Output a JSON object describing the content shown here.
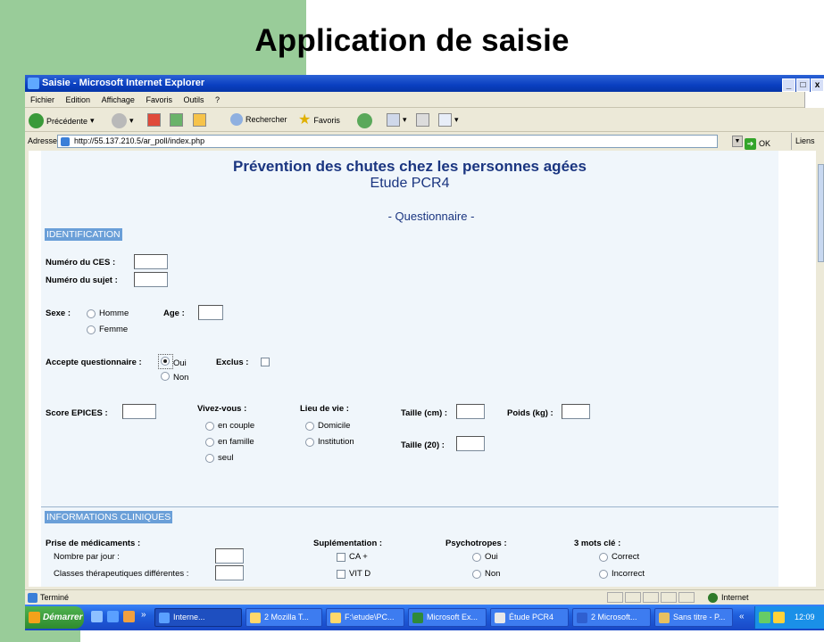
{
  "slide": {
    "title": "Application de saisie"
  },
  "browser": {
    "title": "Saisie - Microsoft Internet Explorer",
    "window_buttons": [
      "_",
      "□",
      "x"
    ],
    "menu": [
      "Fichier",
      "Edition",
      "Affichage",
      "Favoris",
      "Outils",
      "?"
    ],
    "toolbar": {
      "back": "Précédente",
      "search": "Rechercher",
      "favorites": "Favoris"
    },
    "address_label": "Adresse",
    "url": "http://55.137.210.5/ar_poll/index.php",
    "go_label": "OK",
    "links_label": "Liens"
  },
  "page": {
    "heading": "Prévention des chutes chez les personnes agées",
    "subheading": "Etude PCR4",
    "questionnaire": "- Questionnaire -",
    "section_identification": "IDENTIFICATION",
    "num_ces": "Numéro du CES :",
    "num_sujet": "Numéro du sujet :",
    "sexe": "Sexe :",
    "sexe_options": [
      "Homme",
      "Femme"
    ],
    "age": "Age :",
    "accepte": "Accepte questionnaire :",
    "accepte_options": [
      "Oui",
      "Non"
    ],
    "accepte_selected": "Oui",
    "exclus": "Exclus :",
    "score": "Score EPICES :",
    "vivez": "Vivez-vous :",
    "vivez_options": [
      "en couple",
      "en famille",
      "seul"
    ],
    "lieu": "Lieu de vie :",
    "lieu_options": [
      "Domicile",
      "Institution"
    ],
    "taille": "Taille (cm) :",
    "taille20": "Taille (20) :",
    "poids": "Poids (kg) :",
    "section_cliniques": "INFORMATIONS CLINIQUES",
    "prise": "Prise de médicaments :",
    "nombre": "Nombre par jour :",
    "classes": "Classes thérapeutiques différentes :",
    "suplementation": "Suplémentation :",
    "supl_options": [
      "CA +",
      "VIT D"
    ],
    "psychotropes": "Psychotropes :",
    "psy_options": [
      "Oui",
      "Non"
    ],
    "mots": "3 mots clé :",
    "mots_options": [
      "Correct",
      "Incorrect"
    ]
  },
  "status": {
    "text": "Terminé",
    "zone": "Internet"
  },
  "taskbar": {
    "start": "Démarrer",
    "tasks": [
      "Interne...",
      "2 Mozilla T...",
      "F:\\etude\\PC...",
      "Microsoft Ex...",
      "Étude PCR4",
      "2 Microsoft...",
      "Sans titre - P..."
    ],
    "clock": "12:09"
  },
  "colors": {
    "title_blue": "#1a3580",
    "form_bg": "#f0f6fb",
    "section_bg": "#6a9fd8",
    "slide_green": "#99cc99"
  }
}
